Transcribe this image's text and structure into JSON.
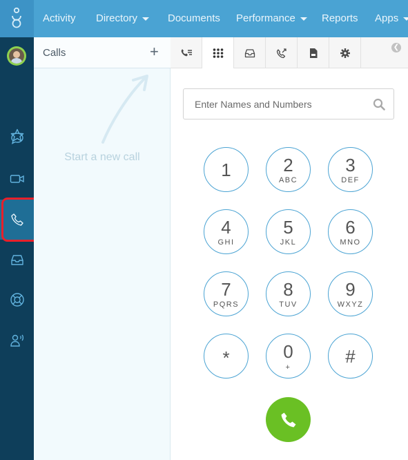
{
  "nav": {
    "items": [
      {
        "label": "Activity"
      },
      {
        "label": "Directory"
      },
      {
        "label": "Documents"
      },
      {
        "label": "Performance"
      },
      {
        "label": "Reports"
      },
      {
        "label": "Apps"
      }
    ]
  },
  "rail": {
    "items": [
      "avatar",
      "favorites-icon",
      "chat-icon",
      "video-icon",
      "phone-icon",
      "inbox-icon",
      "support-icon",
      "voice-user-icon"
    ],
    "active": "phone-icon"
  },
  "calls": {
    "title": "Calls",
    "add_symbol": "+",
    "empty_hint": "Start a new call"
  },
  "tabs": [
    "call-log-icon",
    "dialpad-icon",
    "inbox-icon",
    "voicemail-icon",
    "document-icon",
    "settings-icon"
  ],
  "search": {
    "placeholder": "Enter Names and Numbers"
  },
  "dialpad": {
    "keys": [
      {
        "digit": "1",
        "letters": ""
      },
      {
        "digit": "2",
        "letters": "ABC"
      },
      {
        "digit": "3",
        "letters": "DEF"
      },
      {
        "digit": "4",
        "letters": "GHI"
      },
      {
        "digit": "5",
        "letters": "JKL"
      },
      {
        "digit": "6",
        "letters": "MNO"
      },
      {
        "digit": "7",
        "letters": "PQRS"
      },
      {
        "digit": "8",
        "letters": "TUV"
      },
      {
        "digit": "9",
        "letters": "WXYZ"
      },
      {
        "digit": "*",
        "letters": ""
      },
      {
        "digit": "0",
        "letters": "+"
      },
      {
        "digit": "#",
        "letters": ""
      }
    ]
  },
  "colors": {
    "nav": "#4aa3d3",
    "rail": "#0e3e5a",
    "rail_active": "#1f6e96",
    "call_button": "#6ac024",
    "highlight": "#e8202a"
  }
}
